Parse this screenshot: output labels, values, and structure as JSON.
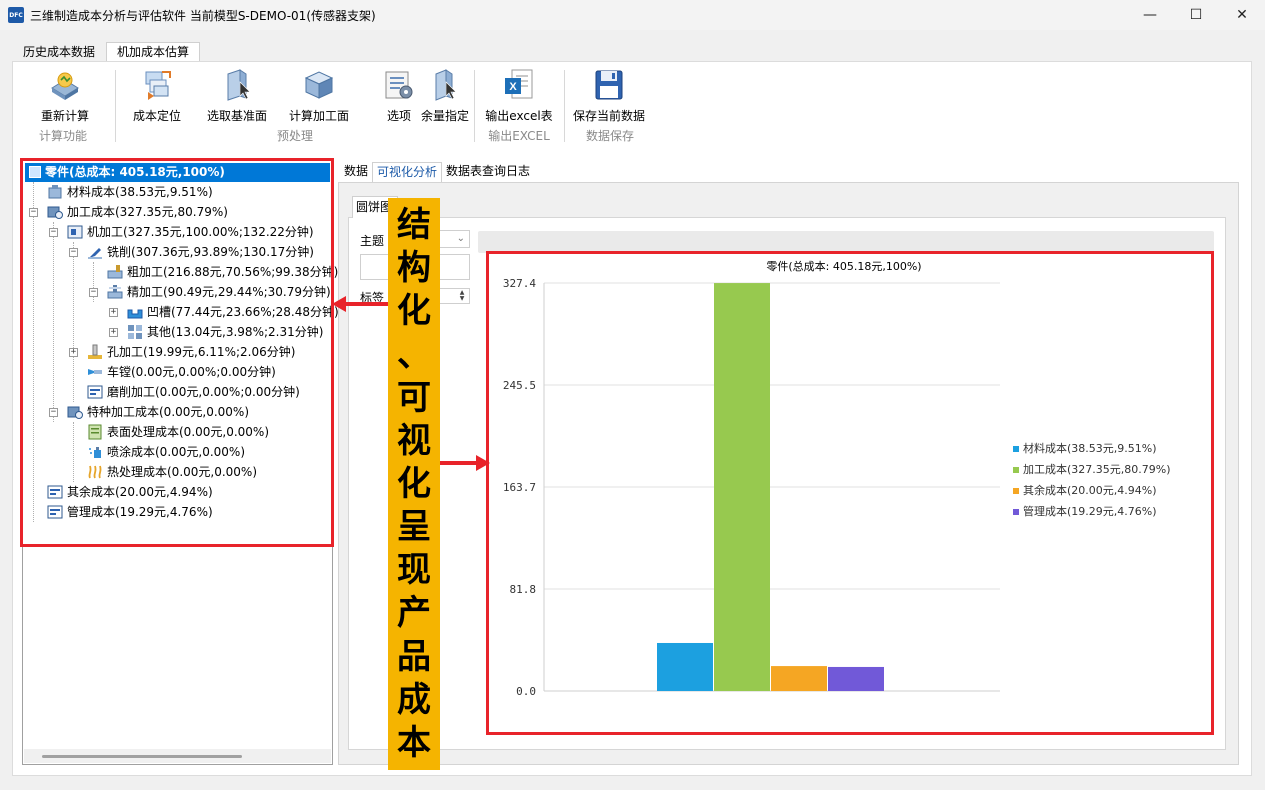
{
  "window": {
    "title": "三维制造成本分析与评估软件 当前模型S-DEMO-01(传感器支架)",
    "icon_text": "DFC",
    "controls": [
      "minimize-icon",
      "maximize-icon",
      "close-icon"
    ]
  },
  "main_tabs": [
    {
      "label": "历史成本数据",
      "active": false
    },
    {
      "label": "机加成本估算",
      "active": true
    }
  ],
  "ribbon": {
    "groups": [
      {
        "label": "计算功能",
        "buttons": [
          {
            "label": "重新计算",
            "icon": "recalculate-icon"
          }
        ]
      },
      {
        "label": "预处理",
        "buttons": [
          {
            "label": "成本定位",
            "icon": "cost-locate-icon"
          },
          {
            "label": "选取基准面",
            "icon": "select-datum-icon"
          },
          {
            "label": "计算加工面",
            "icon": "calc-surface-icon"
          },
          {
            "label": "选项",
            "icon": "options-icon"
          },
          {
            "label": "余量指定",
            "icon": "allowance-icon"
          }
        ]
      },
      {
        "label": "输出EXCEL",
        "buttons": [
          {
            "label": "输出excel表",
            "icon": "excel-icon"
          }
        ]
      },
      {
        "label": "数据保存",
        "buttons": [
          {
            "label": "保存当前数据",
            "icon": "save-icon"
          }
        ]
      }
    ]
  },
  "tree": {
    "root": "零件(总成本: 405.18元,100%)",
    "nodes": [
      {
        "label": "材料成本(38.53元,9.51%)",
        "icon": "material-icon"
      },
      {
        "label": "加工成本(327.35元,80.79%)",
        "icon": "process-icon"
      },
      {
        "label": "机加工(327.35元,100.00%;132.22分钟)",
        "icon": "machining-icon"
      },
      {
        "label": "铣削(307.36元,93.89%;130.17分钟)",
        "icon": "milling-icon"
      },
      {
        "label": "粗加工(216.88元,70.56%;99.38分钟)",
        "icon": "rough-icon"
      },
      {
        "label": "精加工(90.49元,29.44%;30.79分钟)",
        "icon": "finish-icon"
      },
      {
        "label": "凹槽(77.44元,23.66%;28.48分钟)",
        "icon": "groove-icon"
      },
      {
        "label": "其他(13.04元,3.98%;2.31分钟)",
        "icon": "other-icon"
      },
      {
        "label": "孔加工(19.99元,6.11%;2.06分钟)",
        "icon": "hole-icon"
      },
      {
        "label": "车镗(0.00元,0.00%;0.00分钟)",
        "icon": "turning-icon"
      },
      {
        "label": "磨削加工(0.00元,0.00%;0.00分钟)",
        "icon": "grinding-icon"
      },
      {
        "label": "特种加工成本(0.00元,0.00%)",
        "icon": "special-icon"
      },
      {
        "label": "表面处理成本(0.00元,0.00%)",
        "icon": "surface-icon"
      },
      {
        "label": "喷涂成本(0.00元,0.00%)",
        "icon": "spray-icon"
      },
      {
        "label": "热处理成本(0.00元,0.00%)",
        "icon": "heat-icon"
      },
      {
        "label": "其余成本(20.00元,4.94%)",
        "icon": "misc-icon"
      },
      {
        "label": "管理成本(19.29元,4.76%)",
        "icon": "management-icon"
      }
    ]
  },
  "sub_tabs": [
    {
      "label": "数据",
      "active": false
    },
    {
      "label": "可视化分析",
      "active": true
    },
    {
      "label": "数据表查询日志",
      "active": false
    }
  ],
  "inner_tab": "圆饼图",
  "options": {
    "theme_label": "主题",
    "label_label": "标签"
  },
  "banner_text": [
    "结",
    "构",
    "化",
    "、",
    "可",
    "视",
    "化",
    "呈",
    "现",
    "产",
    "品",
    "成",
    "本"
  ],
  "colors": {
    "accent": "#0078d7",
    "annotation_red": "#e8232a",
    "banner": "#f5b400"
  },
  "chart_data": {
    "type": "bar",
    "title": "零件(总成本: 405.18元,100%)",
    "categories": [
      "材料成本(38.53元,9.51%)",
      "加工成本(327.35元,80.79%)",
      "其余成本(20.00元,4.94%)",
      "管理成本(19.29元,4.76%)"
    ],
    "values": [
      38.53,
      327.35,
      20.0,
      19.29
    ],
    "colors": [
      "#1ca0e0",
      "#97c94f",
      "#f5a623",
      "#7159d8"
    ],
    "yticks": [
      "0.0",
      "81.8",
      "163.7",
      "245.5",
      "327.4"
    ],
    "ylim": [
      0,
      327.4
    ],
    "grid": true,
    "legend": "right"
  }
}
